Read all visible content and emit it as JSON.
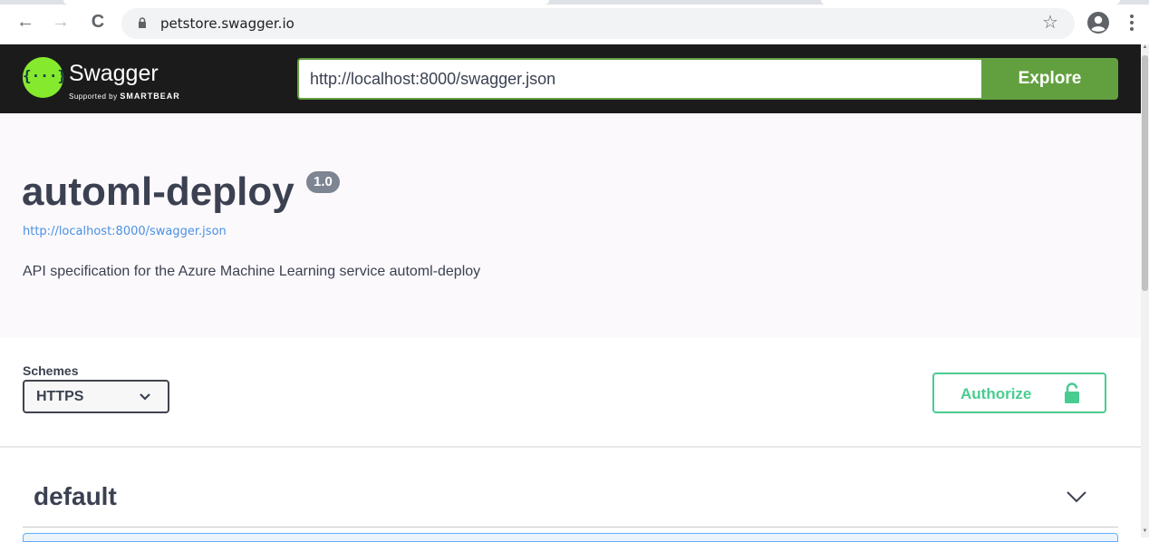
{
  "browser": {
    "url": "petstore.swagger.io",
    "back_glyph": "←",
    "forward_glyph": "→",
    "reload_glyph": "C",
    "star_glyph": "☆"
  },
  "topbar": {
    "logo_word": "Swagger",
    "logo_sub_prefix": "Supported by ",
    "logo_sub_brand": "SMARTBEAR",
    "logo_braces": "{···}",
    "spec_url_value": "http://localhost:8000/swagger.json",
    "explore_label": "Explore"
  },
  "info": {
    "title": "automl-deploy",
    "version": "1.0",
    "spec_link": "http://localhost:8000/swagger.json",
    "description": "API specification for the Azure Machine Learning service automl-deploy"
  },
  "schemes": {
    "label": "Schemes",
    "selected": "HTTPS",
    "authorize_label": "Authorize"
  },
  "operations": {
    "tag": "default"
  },
  "colors": {
    "swagger_green": "#62a03f",
    "logo_green": "#85ea2d",
    "authorize_green": "#49cc90",
    "topbar_bg": "#1b1b1b",
    "text_dark": "#3b4151",
    "link_blue": "#4990e2"
  }
}
